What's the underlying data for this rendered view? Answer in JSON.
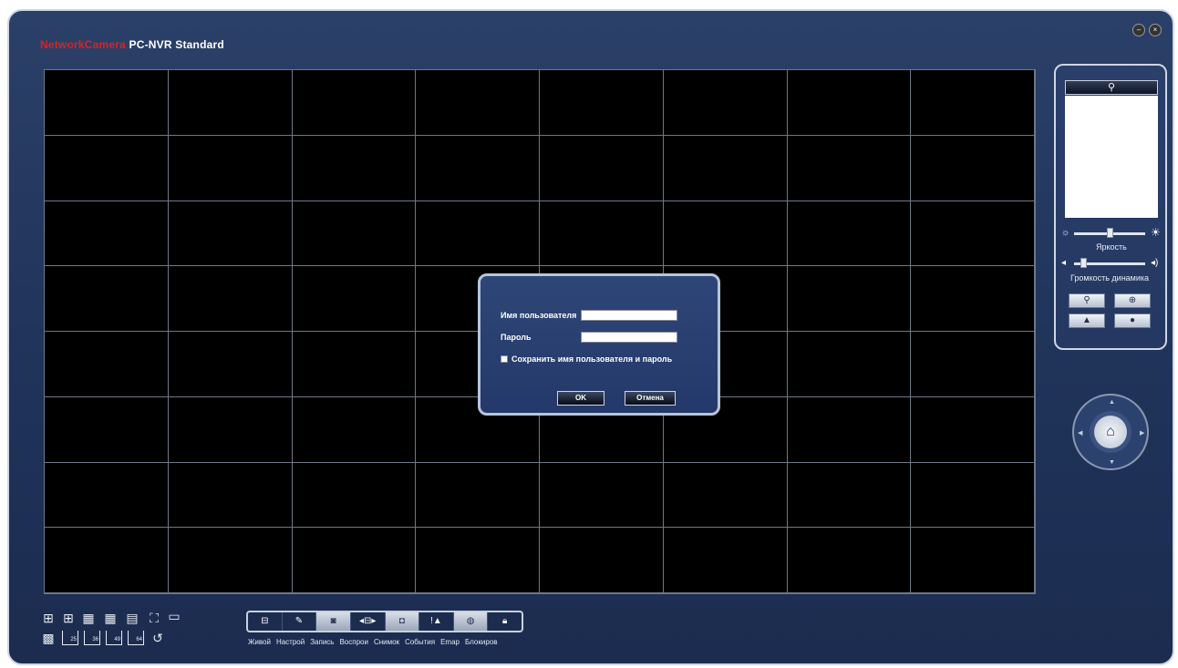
{
  "app": {
    "brand": "NetworkCamera",
    "title": "PC-NVR Standard",
    "minimize_icon": "minimize-icon",
    "close_icon": "close-icon"
  },
  "login_dialog": {
    "username_label": "Имя пользователя",
    "username_value": "",
    "password_label": "Пароль",
    "password_value": "",
    "remember_label": "Сохранить имя пользователя и пароль",
    "remember_checked": false,
    "ok_label": "OK",
    "cancel_label": "Отмена"
  },
  "side_panel": {
    "preview_icon": "search-camera-icon",
    "brightness_label": "Яркость",
    "brightness_level": 0.5,
    "volume_label": "Громкость динамика",
    "volume_level": 0.1,
    "buttons": [
      "zoom-out-icon",
      "zoom-in-icon",
      "focus-icon",
      "iris-icon"
    ]
  },
  "ptz": {
    "home_icon": "home-icon"
  },
  "layout_buttons": [
    "layout-4-icon",
    "layout-9-icon",
    "layout-16-icon",
    "layout-10-icon",
    "layout-13-icon",
    "fullscreen-icon",
    "window-icon",
    "layout-20-icon",
    "25",
    "36",
    "49",
    "64",
    "refresh-icon"
  ],
  "toolbar": {
    "items": [
      {
        "icon": "grid-icon",
        "label": "Живой"
      },
      {
        "icon": "wrench-icon",
        "label": "Настрой"
      },
      {
        "icon": "record-icon",
        "label": "Запись"
      },
      {
        "icon": "playback-icon",
        "label": "Воспрои"
      },
      {
        "icon": "camera-icon",
        "label": "Снимок"
      },
      {
        "icon": "alarm-icon",
        "label": "События"
      },
      {
        "icon": "globe-icon",
        "label": "Emap"
      },
      {
        "icon": "lock-icon",
        "label": "Блокиров"
      }
    ]
  }
}
